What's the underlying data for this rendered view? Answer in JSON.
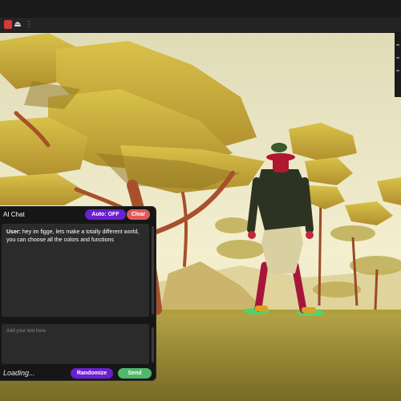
{
  "toolbar": {
    "record_icon": "record-icon",
    "eject_icon": "eject-icon",
    "more_icon": "more-dots-icon"
  },
  "scene": {
    "description_icon": "game-viewport",
    "colors": {
      "sky": "#ece8c8",
      "ground": "#9b8a2a",
      "foliage": "#c6ad3c",
      "trunk": "#a3502a"
    }
  },
  "chat": {
    "title": "AI Chat",
    "auto_label": "Auto: OFF",
    "clear_label": "Clear",
    "message_sender": "User:",
    "message_text": " hey im figge, lets make a totally different world, you can choose all the colors and functions",
    "input_placeholder": "Add your text here",
    "status": "Loading...",
    "randomize_label": "Randomize",
    "send_label": "Send",
    "colors": {
      "purple": "#6a1fd0",
      "red": "#e05a5a",
      "green": "#4fb86a"
    }
  }
}
